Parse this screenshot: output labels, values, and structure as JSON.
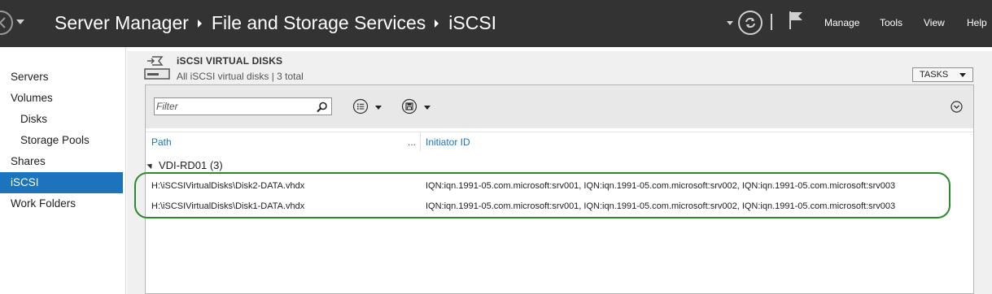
{
  "titlebar": {
    "breadcrumb": [
      "Server Manager",
      "File and Storage Services",
      "iSCSI"
    ],
    "menu": [
      "Manage",
      "Tools",
      "View",
      "Help"
    ]
  },
  "sidebar": {
    "items": [
      {
        "label": "Servers",
        "sub": false,
        "active": false
      },
      {
        "label": "Volumes",
        "sub": false,
        "active": false
      },
      {
        "label": "Disks",
        "sub": true,
        "active": false
      },
      {
        "label": "Storage Pools",
        "sub": true,
        "active": false
      },
      {
        "label": "Shares",
        "sub": false,
        "active": false
      },
      {
        "label": "iSCSI",
        "sub": false,
        "active": true
      },
      {
        "label": "Work Folders",
        "sub": false,
        "active": false
      }
    ]
  },
  "section": {
    "title": "iSCSI VIRTUAL DISKS",
    "subtitle": "All iSCSI virtual disks | 3 total",
    "tasks_label": "TASKS"
  },
  "filter": {
    "placeholder": "Filter"
  },
  "table": {
    "columns": [
      "Path",
      "...",
      "Initiator ID"
    ],
    "group": "VDI-RD01 (3)",
    "rows": [
      {
        "path": "H:\\iSCSIVirtualDisks\\Disk2-DATA.vhdx",
        "initiator_id": "IQN:iqn.1991-05.com.microsoft:srv001, IQN:iqn.1991-05.com.microsoft:srv002, IQN:iqn.1991-05.com.microsoft:srv003"
      },
      {
        "path": "H:\\iSCSIVirtualDisks\\Disk1-DATA.vhdx",
        "initiator_id": "IQN:iqn.1991-05.com.microsoft:srv001, IQN:iqn.1991-05.com.microsoft:srv002, IQN:iqn.1991-05.com.microsoft:srv003"
      }
    ]
  },
  "colors": {
    "titlebar_bg": "#333333",
    "accent": "#1c75bc",
    "highlight": "#2b8a2b"
  },
  "icons": [
    "back-arrow-icon",
    "refresh-icon",
    "flag-icon",
    "disk-icon",
    "search-icon",
    "list-view-icon",
    "save-query-icon",
    "collapse-icon"
  ]
}
